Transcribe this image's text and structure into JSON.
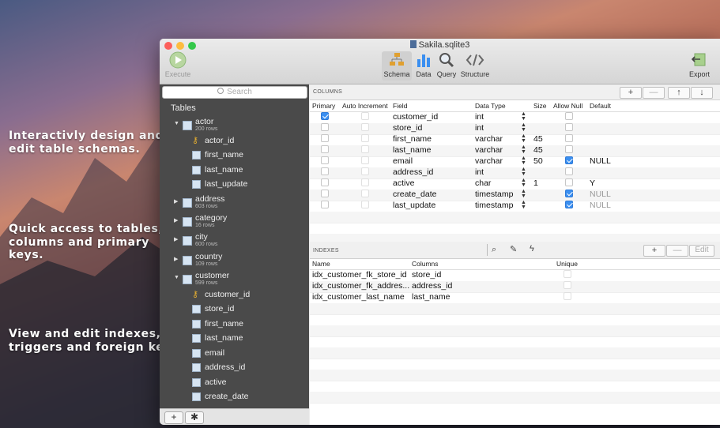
{
  "promo": [
    "Interactivly design and\nedit table schemas.",
    "Quick access to tables,\ncolumns and primary\nkeys.",
    "View and edit indexes,\ntriggers and foreign keys."
  ],
  "window": {
    "title": "Sakila.sqlite3"
  },
  "toolbar": {
    "execute": "Execute",
    "schema": "Schema",
    "data": "Data",
    "query": "Query",
    "structure": "Structure",
    "export": "Export"
  },
  "sidebar": {
    "search_placeholder": "Search",
    "tables_header": "Tables",
    "tables": [
      {
        "name": "actor",
        "rows": "200 rows",
        "expanded": true,
        "columns": [
          "actor_id",
          "first_name",
          "last_name",
          "last_update"
        ]
      },
      {
        "name": "address",
        "rows": "603 rows"
      },
      {
        "name": "category",
        "rows": "16 rows"
      },
      {
        "name": "city",
        "rows": "600 rows"
      },
      {
        "name": "country",
        "rows": "109 rows"
      },
      {
        "name": "customer",
        "rows": "599 rows",
        "expanded": true,
        "columns": [
          "customer_id",
          "store_id",
          "first_name",
          "last_name",
          "email",
          "address_id",
          "active",
          "create_date"
        ]
      }
    ],
    "add_label": "+",
    "gear_label": "✱"
  },
  "columns_section": {
    "title": "COLUMNS",
    "headers": {
      "primary": "Primary",
      "auto_increment": "Auto Increment",
      "field": "Field",
      "data_type": "Data Type",
      "size": "Size",
      "allow_null": "Allow Null",
      "default": "Default"
    },
    "buttons": {
      "add": "+",
      "remove": "—",
      "up": "↑",
      "down": "↓"
    },
    "rows": [
      {
        "primary": true,
        "field": "customer_id",
        "type": "int",
        "size": "",
        "allow_null": false,
        "default": "",
        "dim_default": false
      },
      {
        "primary": false,
        "field": "store_id",
        "type": "int",
        "size": "",
        "allow_null": false,
        "default": "",
        "dim_default": false
      },
      {
        "primary": false,
        "field": "first_name",
        "type": "varchar",
        "size": "45",
        "allow_null": false,
        "default": "",
        "dim_default": false
      },
      {
        "primary": false,
        "field": "last_name",
        "type": "varchar",
        "size": "45",
        "allow_null": false,
        "default": "",
        "dim_default": false
      },
      {
        "primary": false,
        "field": "email",
        "type": "varchar",
        "size": "50",
        "allow_null": true,
        "default": "NULL",
        "dim_default": false
      },
      {
        "primary": false,
        "field": "address_id",
        "type": "int",
        "size": "",
        "allow_null": false,
        "default": "",
        "dim_default": false
      },
      {
        "primary": false,
        "field": "active",
        "type": "char",
        "size": "1",
        "allow_null": false,
        "default": "Y",
        "dim_default": false
      },
      {
        "primary": false,
        "field": "create_date",
        "type": "timestamp",
        "size": "",
        "allow_null": true,
        "default": "NULL",
        "dim_default": true
      },
      {
        "primary": false,
        "field": "last_update",
        "type": "timestamp",
        "size": "",
        "allow_null": true,
        "default": "NULL",
        "dim_default": true
      }
    ]
  },
  "indexes_section": {
    "title": "INDEXES",
    "headers": {
      "name": "Name",
      "columns": "Columns",
      "unique": "Unique"
    },
    "buttons": {
      "add": "+",
      "remove": "—",
      "edit": "Edit"
    },
    "rows": [
      {
        "name": "idx_customer_fk_store_id",
        "columns": "store_id",
        "unique": false
      },
      {
        "name": "idx_customer_fk_addres...",
        "columns": "address_id",
        "unique": false
      },
      {
        "name": "idx_customer_last_name",
        "columns": "last_name",
        "unique": false
      }
    ]
  },
  "colors": {
    "accent": "#3b8ff0",
    "sidebar_bg": "#4a4a4a"
  }
}
